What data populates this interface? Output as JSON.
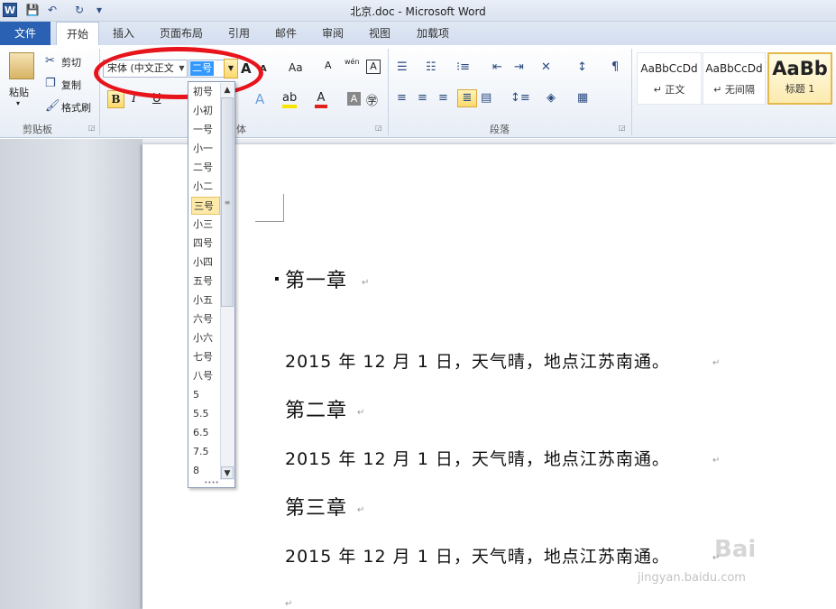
{
  "window": {
    "title": "北京.doc - Microsoft Word",
    "app_icon": "W"
  },
  "quick_access": {
    "save_icon": "💾",
    "undo_icon": "↶",
    "redo_icon": "↻",
    "customize_icon": "▾"
  },
  "tabs": {
    "file": "文件",
    "items": [
      "开始",
      "插入",
      "页面布局",
      "引用",
      "邮件",
      "审阅",
      "视图",
      "加载项"
    ]
  },
  "clipboard": {
    "paste": "粘贴",
    "cut": "剪切",
    "copy": "复制",
    "format_painter": "格式刷",
    "group_label": "剪贴板"
  },
  "font": {
    "name": "宋体 (中文正文",
    "size": "二号",
    "group_label": "体",
    "grow_icon": "A",
    "shrink_icon": "A",
    "aa": "Aa",
    "clear_icon": "A",
    "pinyin": "wén",
    "char_border": "A"
  },
  "paragraph": {
    "group_label": "段落"
  },
  "styles": [
    {
      "sample": "AaBbCcDd",
      "name": "↵ 正文"
    },
    {
      "sample": "AaBbCcDd",
      "name": "↵ 无间隔"
    },
    {
      "sample": "AaBb",
      "name": "标题 1"
    }
  ],
  "size_dropdown": {
    "options": [
      "初号",
      "小初",
      "一号",
      "小一",
      "二号",
      "小二",
      "三号",
      "小三",
      "四号",
      "小四",
      "五号",
      "小五",
      "六号",
      "小六",
      "七号",
      "八号",
      "5",
      "5.5",
      "6.5",
      "7.5",
      "8"
    ],
    "selected": "三号"
  },
  "document": {
    "lines": [
      {
        "type": "heading",
        "text": "第一章"
      },
      {
        "type": "body",
        "text": "2015 年 12 月 1 日，天气晴，地点江苏南通。"
      },
      {
        "type": "heading",
        "text": "第二章"
      },
      {
        "type": "body",
        "text": "2015 年 12 月 1 日，天气晴，地点江苏南通。"
      },
      {
        "type": "heading",
        "text": "第三章"
      },
      {
        "type": "body",
        "text": "2015 年 12 月 1 日，天气晴，地点江苏南通。"
      }
    ],
    "paragraph_mark": "↵"
  },
  "watermark": {
    "text": "jingyan.baidu.com",
    "brand": "Bai"
  },
  "colors": {
    "file_tab": "#2a61b2",
    "highlight_ring": "#e8141c",
    "selection": "#3399ff"
  }
}
